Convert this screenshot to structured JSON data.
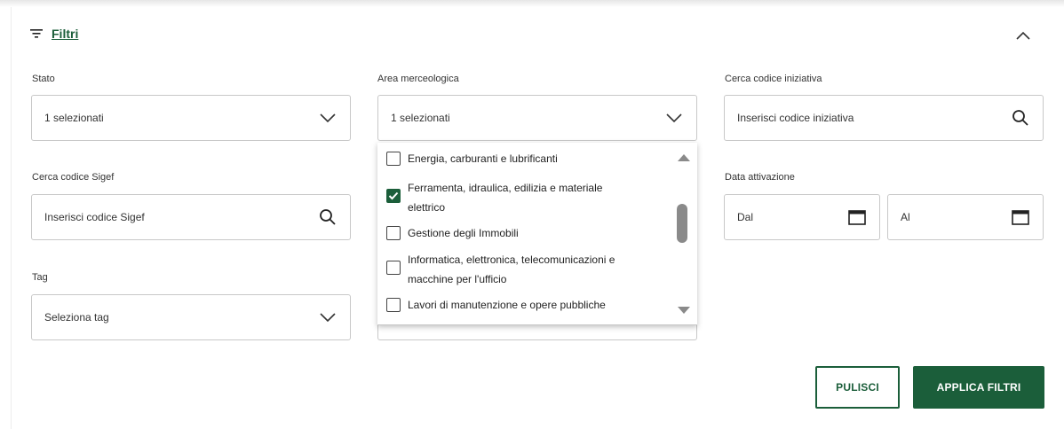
{
  "header": {
    "title": "Filtri",
    "filter_icon": "filter-lines-icon",
    "collapse_icon": "chevron-up-icon"
  },
  "fields": {
    "stato": {
      "label": "Stato",
      "value": "1 selezionati"
    },
    "area": {
      "label": "Area merceologica",
      "value": "1 selezionati"
    },
    "codice_iniziativa": {
      "label": "Cerca codice iniziativa",
      "placeholder": "Inserisci codice iniziativa"
    },
    "codice_sigef": {
      "label": "Cerca codice Sigef",
      "placeholder": "Inserisci codice Sigef"
    },
    "data_attivazione": {
      "label": "Data attivazione",
      "dal": "Dal",
      "al": "Al"
    },
    "tag": {
      "label": "Tag",
      "value": "Seleziona tag"
    }
  },
  "area_options": [
    {
      "line1": "Energia, carburanti e lubrificanti",
      "line2": "",
      "checked": false
    },
    {
      "line1": "Ferramenta, idraulica, edilizia e materiale",
      "line2": "elettrico",
      "checked": true
    },
    {
      "line1": "Gestione degli Immobili",
      "line2": "",
      "checked": false
    },
    {
      "line1": "Informatica, elettronica, telecomunicazioni e",
      "line2": "macchine per l'ufficio",
      "checked": false
    },
    {
      "line1": "Lavori di manutenzione e opere pubbliche",
      "line2": "",
      "checked": false
    }
  ],
  "buttons": {
    "clear": "PULISCI",
    "apply": "APPLICA FILTRI"
  },
  "colors": {
    "accent": "#1b5e3a",
    "border": "#c8c8c8"
  }
}
